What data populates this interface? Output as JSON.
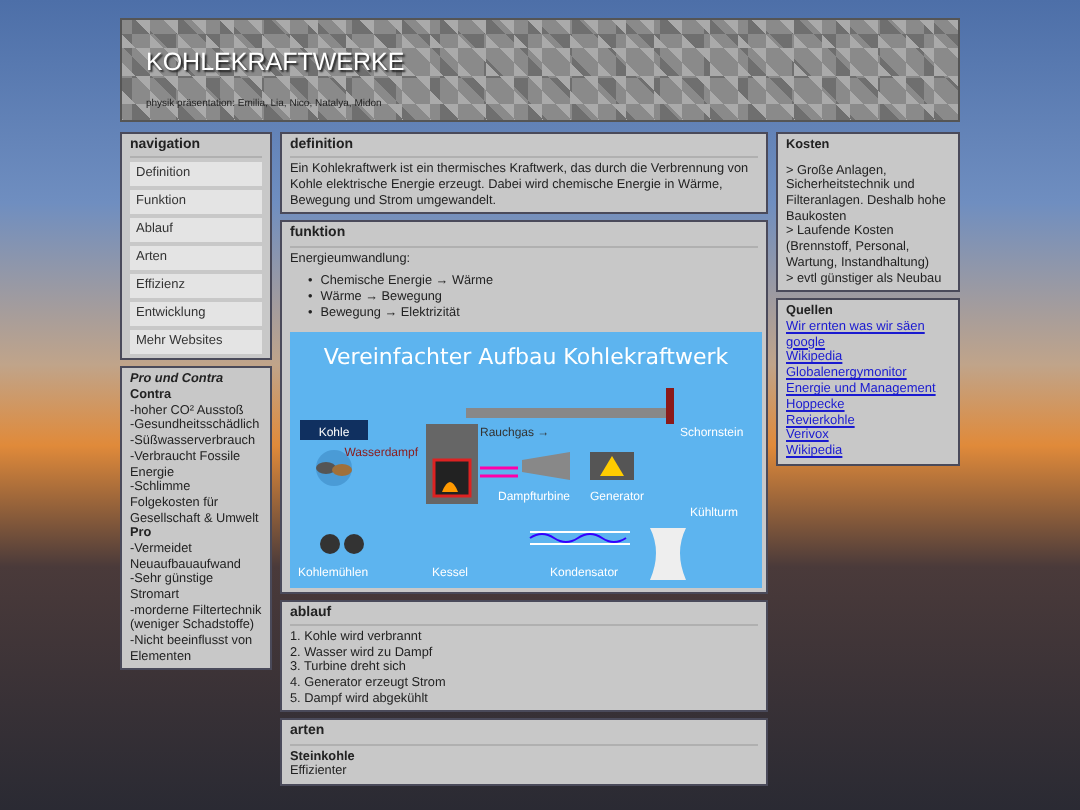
{
  "header": {
    "title": "KOHLEKRAFTWERKE",
    "subtitle": "physik präsentation: Emilia, Lia, Nico, Natalya, Midon"
  },
  "navigation": {
    "title": "navigation",
    "items": [
      {
        "label": "Definition"
      },
      {
        "label": "Funktion"
      },
      {
        "label": "Ablauf"
      },
      {
        "label": "Arten"
      },
      {
        "label": "Effizienz"
      },
      {
        "label": "Entwicklung"
      },
      {
        "label": "Mehr Websites"
      }
    ]
  },
  "pro_contra": {
    "title": "Pro und Contra",
    "sections": [
      {
        "heading": "Contra",
        "lines": [
          "-hoher CO² Ausstoß",
          "-Gesundheitsschädlich",
          "-Süßwasserverbrauch",
          "-Verbraucht Fossile Energie",
          "-Schlimme Folgekosten für Gesellschaft & Umwelt"
        ]
      },
      {
        "heading": "Pro",
        "lines": [
          "-Vermeidet Neuaufbauaufwand",
          "-Sehr günstige Stromart",
          "-morderne Filtertechnik (weniger Schadstoffe)",
          "-Nicht beeinflusst von Elementen"
        ]
      }
    ]
  },
  "definition": {
    "title": "definition",
    "text": "Ein Kohlekraftwerk ist ein thermisches Kraftwerk, das durch die Verbrennung von Kohle elektrische Energie erzeugt. Dabei wird chemische Energie in Wärme, Bewegung und Strom umgewandelt."
  },
  "funktion": {
    "title": "funktion",
    "intro": "Energieumwandlung:",
    "bullets": [
      {
        "marker": "•",
        "text": "Chemische Energie → Wärme"
      },
      {
        "marker": "•",
        "text": "Wärme → Bewegung"
      },
      {
        "marker": "•",
        "text": "Bewegung → Elektrizität"
      }
    ],
    "diagram": {
      "title": "Vereinfachter Aufbau Kohlekraftwerk",
      "labels": [
        "Kohle",
        "Rauchgas →",
        "Schornstein",
        "Wasserdampf",
        "Dampfturbine",
        "Generator",
        "Kühlturm",
        "Kohlemühlen",
        "Kessel",
        "Kondensator"
      ]
    }
  },
  "ablauf": {
    "title": "ablauf",
    "steps": [
      "1. Kohle wird verbrannt",
      "2. Wasser wird zu Dampf",
      "3. Turbine dreht sich",
      "4. Generator erzeugt Strom",
      "5. Dampf wird abgekühlt"
    ]
  },
  "arten": {
    "title": "arten",
    "heading": "Steinkohle",
    "lines": [
      "Effizienter"
    ]
  },
  "kosten": {
    "title": "Kosten",
    "lines": [
      "> Große Anlagen, Sicherheitstechnik und Filteranlagen. Deshalb hohe Baukosten",
      "> Laufende Kosten (Brennstoff, Personal, Wartung, Instandhaltung)",
      "> evtl günstiger als Neubau"
    ]
  },
  "quellen": {
    "title": "Quellen",
    "links": [
      "Wir ernten was wir säen",
      "google",
      "Wikipedia",
      "Globalenergymonitor",
      "Energie und Management",
      "Hoppecke",
      "Revierkohle",
      "Verivox",
      "Wikipedia"
    ]
  }
}
